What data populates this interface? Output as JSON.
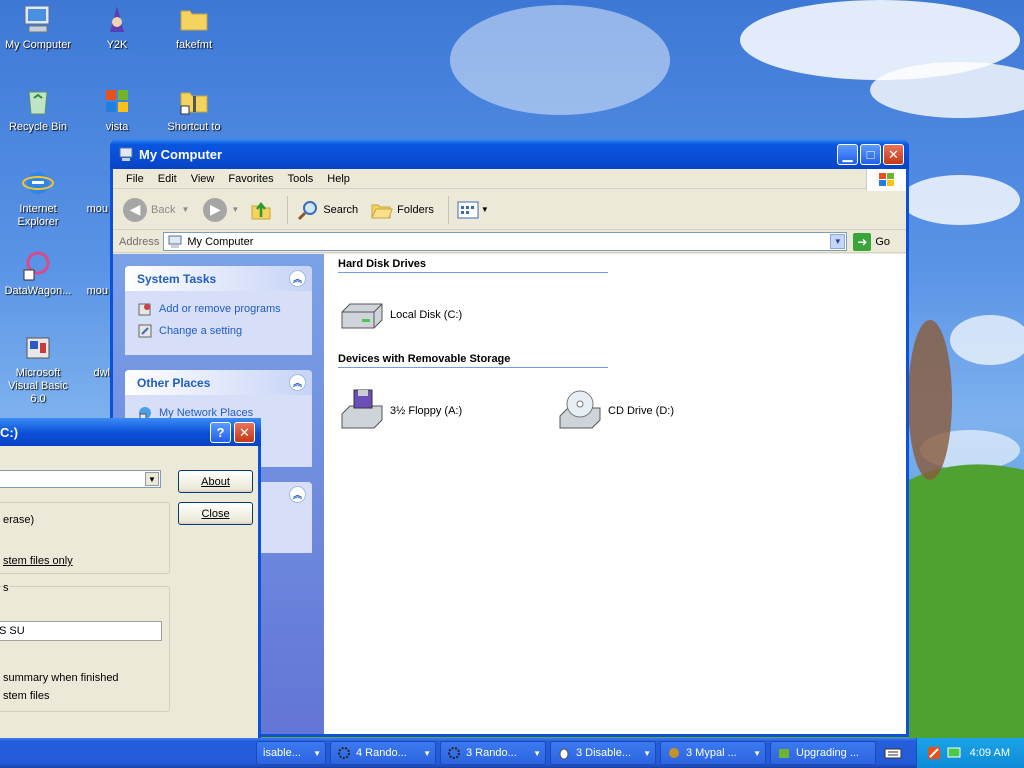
{
  "desktop": {
    "icons": [
      {
        "label": "My Computer"
      },
      {
        "label": "Y2K"
      },
      {
        "label": "fakefmt"
      },
      {
        "label": "Recycle Bin"
      },
      {
        "label": "vista"
      },
      {
        "label": "Shortcut to"
      },
      {
        "label": "Internet Explorer"
      },
      {
        "label": "mou"
      },
      {
        "label": "DataWagon..."
      },
      {
        "label": "mou"
      },
      {
        "label": "Microsoft Visual Basic 6.0"
      },
      {
        "label": "dwl"
      }
    ]
  },
  "explorer": {
    "title": "My Computer",
    "menu": [
      "File",
      "Edit",
      "View",
      "Favorites",
      "Tools",
      "Help"
    ],
    "toolbar": {
      "back": "Back",
      "search": "Search",
      "folders": "Folders"
    },
    "address": {
      "label": "Address",
      "value": "My Computer",
      "go": "Go"
    },
    "system_tasks": {
      "title": "System Tasks",
      "items": [
        "Add or remove programs",
        "Change a setting"
      ]
    },
    "other_places": {
      "title": "Other Places",
      "items": [
        "My Network Places"
      ]
    },
    "sections": {
      "hard_disks": {
        "title": "Hard Disk Drives",
        "items": [
          "Local Disk (C:)"
        ]
      },
      "removable": {
        "title": "Devices with Removable Storage",
        "items": [
          "3½ Floppy (A:)",
          "CD Drive (D:)"
        ]
      }
    }
  },
  "dialog": {
    "title": "C:)",
    "help": "?",
    "about": "About",
    "close": "Close",
    "texts": [
      "erase)",
      "stem files only",
      "s",
      "summary when finished",
      "stem files"
    ],
    "textbox_value": "S SU"
  },
  "taskbar": {
    "tasks": [
      "isable...",
      "4 Rando...",
      "3 Rando...",
      "3 Disable...",
      "3 Mypal ...",
      "Upgrading ..."
    ],
    "clock": "4:09 AM"
  },
  "colors": {
    "xp_blue": "#0a53d8",
    "link_blue": "#215dc6",
    "taskbar": "#245edc"
  }
}
